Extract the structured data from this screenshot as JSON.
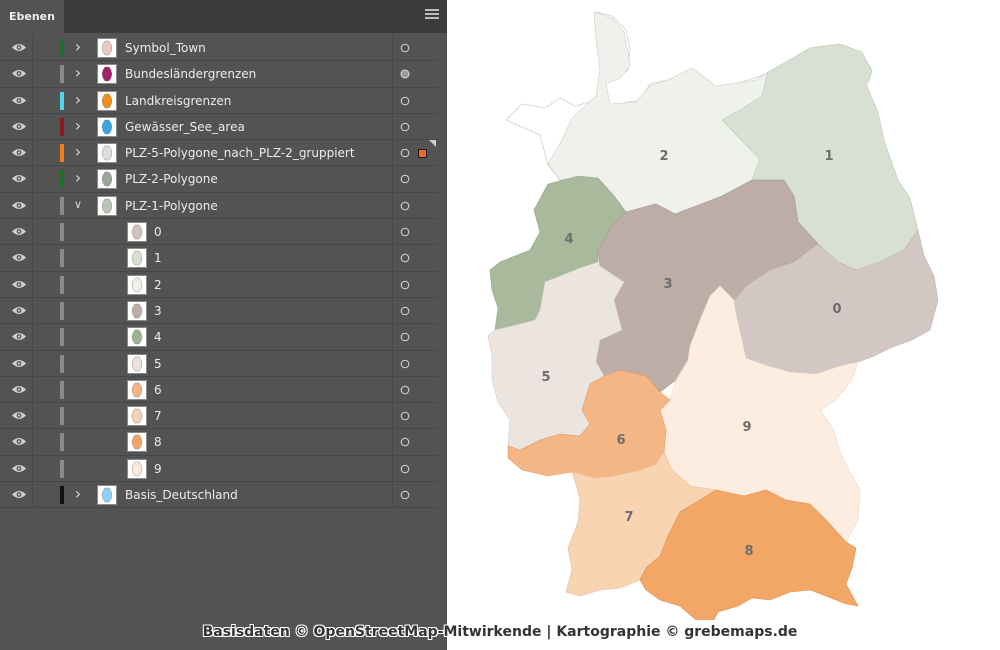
{
  "panel": {
    "tab_label": "Ebenen",
    "menu_icon": "hamburger-menu-icon",
    "layers": [
      {
        "name": "Symbol_Town",
        "color": "#1f6e2a",
        "expandable": true,
        "expanded": false,
        "thumb": "#e8c9c0",
        "indent": 0
      },
      {
        "name": "Bundesländergrenzen",
        "color": "#8a8a8a",
        "expandable": true,
        "expanded": false,
        "thumb": "#a3216b",
        "indent": 0,
        "target_filled": true
      },
      {
        "name": "Landkreisgrenzen",
        "color": "#4fd6e8",
        "expandable": true,
        "expanded": false,
        "thumb": "#f28d1c",
        "indent": 0
      },
      {
        "name": "Gewässer_See_area",
        "color": "#8b1a1a",
        "expandable": true,
        "expanded": false,
        "thumb": "#3aa7e0",
        "indent": 0
      },
      {
        "name": "PLZ-5-Polygone_nach_PLZ-2_gruppiert",
        "color": "#f07e14",
        "expandable": true,
        "expanded": false,
        "thumb": "#dddddd",
        "indent": 0,
        "selected": true
      },
      {
        "name": "PLZ-2-Polygone",
        "color": "#1f6e2a",
        "expandable": true,
        "expanded": false,
        "thumb": "#9aa89a",
        "indent": 0
      },
      {
        "name": "PLZ-1-Polygone",
        "color": "#8a8a8a",
        "expandable": true,
        "expanded": true,
        "thumb": "#b9c4b4",
        "indent": 0
      },
      {
        "name": "0",
        "color": "#8a8a8a",
        "expandable": false,
        "thumb": "#cfc2bf",
        "indent": 1
      },
      {
        "name": "1",
        "color": "#8a8a8a",
        "expandable": false,
        "thumb": "#d6dfd0",
        "indent": 1
      },
      {
        "name": "2",
        "color": "#8a8a8a",
        "expandable": false,
        "thumb": "#eef1ea",
        "indent": 1
      },
      {
        "name": "3",
        "color": "#8a8a8a",
        "expandable": false,
        "thumb": "#bcaea7",
        "indent": 1
      },
      {
        "name": "4",
        "color": "#8a8a8a",
        "expandable": false,
        "thumb": "#9db290",
        "indent": 1
      },
      {
        "name": "5",
        "color": "#8a8a8a",
        "expandable": false,
        "thumb": "#ede3dc",
        "indent": 1
      },
      {
        "name": "6",
        "color": "#8a8a8a",
        "expandable": false,
        "thumb": "#f5b483",
        "indent": 1
      },
      {
        "name": "7",
        "color": "#8a8a8a",
        "expandable": false,
        "thumb": "#f8d3b1",
        "indent": 1
      },
      {
        "name": "8",
        "color": "#8a8a8a",
        "expandable": false,
        "thumb": "#f2a464",
        "indent": 1
      },
      {
        "name": "9",
        "color": "#8a8a8a",
        "expandable": false,
        "thumb": "#fbe9d9",
        "indent": 1
      },
      {
        "name": "Basis_Deutschland",
        "color": "#111111",
        "expandable": true,
        "expanded": false,
        "thumb": "#8fd0f5",
        "indent": 0
      }
    ]
  },
  "map": {
    "regions": [
      {
        "label": "0",
        "color": "#d3c7c4"
      },
      {
        "label": "1",
        "color": "#d7e0d2"
      },
      {
        "label": "2",
        "color": "#eff2ec"
      },
      {
        "label": "3",
        "color": "#bcaea7"
      },
      {
        "label": "4",
        "color": "#a8b99c"
      },
      {
        "label": "5",
        "color": "#ece4df"
      },
      {
        "label": "6",
        "color": "#f4b685"
      },
      {
        "label": "7",
        "color": "#f9d4b3"
      },
      {
        "label": "8",
        "color": "#f3a767"
      },
      {
        "label": "9",
        "color": "#fdece0"
      }
    ]
  },
  "credit": "Basisdaten © OpenStreetMap-Mitwirkende | Kartographie © grebemaps.de"
}
